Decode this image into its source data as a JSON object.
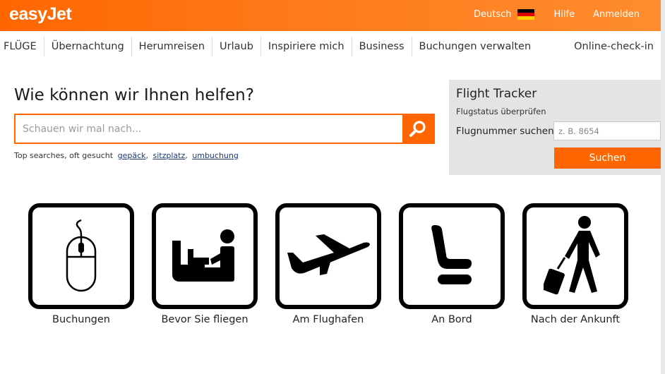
{
  "header": {
    "logo": "easyJet",
    "language": "Deutsch",
    "help": "Hilfe",
    "login": "Anmelden",
    "flag_colors": [
      "#000000",
      "#dd0000",
      "#ffce00"
    ]
  },
  "nav": {
    "items": [
      "FLÜGE",
      "Übernachtung",
      "Herumreisen",
      "Urlaub",
      "Inspiriere mich",
      "Business",
      "Buchungen verwalten"
    ],
    "checkin": "Online-check-in"
  },
  "search": {
    "heading": "Wie können wir Ihnen helfen?",
    "placeholder": "Schauen wir mal nach...",
    "button_icon": "search-icon",
    "top_searches_label": "Top searches, oft gesucht",
    "top_searches": [
      "gepäck",
      "sitzplatz",
      "umbuchung"
    ]
  },
  "tracker": {
    "title": "Flight Tracker",
    "subtitle": "Flugstatus überprüfen",
    "label": "Flugnummer suchen",
    "placeholder": "z. B. 8654",
    "button": "Suchen"
  },
  "tiles": [
    {
      "label": "Buchungen",
      "icon": "mouse-icon"
    },
    {
      "label": "Bevor Sie fliegen",
      "icon": "check-in-desk-icon"
    },
    {
      "label": "Am Flughafen",
      "icon": "airplane-icon"
    },
    {
      "label": "An Bord",
      "icon": "seat-icon"
    },
    {
      "label": "Nach der Ankunft",
      "icon": "traveler-with-suitcase-icon"
    }
  ],
  "colors": {
    "accent": "#ff6600",
    "tracker_bg": "#e4e4e4"
  }
}
